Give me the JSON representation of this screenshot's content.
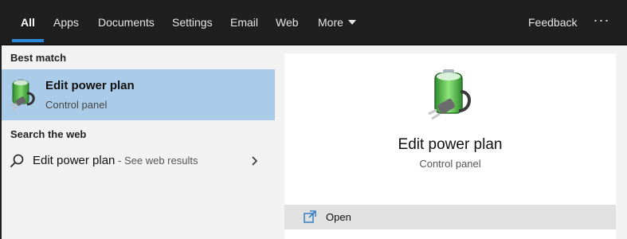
{
  "nav": {
    "tabs": [
      {
        "label": "All",
        "active": true
      },
      {
        "label": "Apps"
      },
      {
        "label": "Documents"
      },
      {
        "label": "Settings"
      },
      {
        "label": "Email"
      },
      {
        "label": "Web"
      },
      {
        "label": "More"
      }
    ],
    "feedback_label": "Feedback",
    "more_options_label": "···",
    "accent_color": "#2b88d8"
  },
  "results": {
    "best_match_header": "Best match",
    "best_match": {
      "title": "Edit power plan",
      "subtitle": "Control panel",
      "icon": "power-plan-icon",
      "highlight_color": "#abcce8"
    },
    "web_header": "Search the web",
    "web_item": {
      "query": "Edit power plan",
      "suffix": " - See web results",
      "icon": "search-icon"
    }
  },
  "preview": {
    "title": "Edit power plan",
    "subtitle": "Control panel",
    "icon": "power-plan-icon",
    "actions": [
      {
        "label": "Open",
        "icon": "open-icon"
      }
    ]
  }
}
